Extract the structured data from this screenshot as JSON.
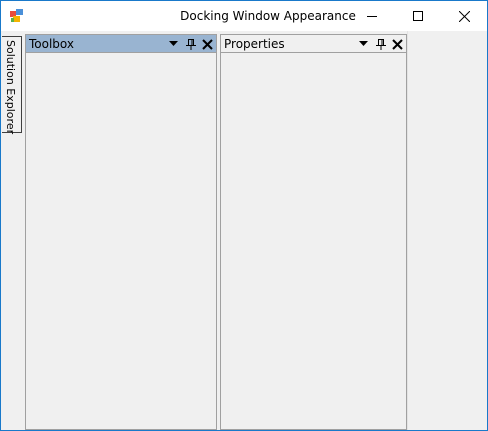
{
  "window": {
    "title": "Docking Window Appearance",
    "icon": "app-icon",
    "caption_buttons": [
      "minimize-icon",
      "maximize-icon",
      "close-icon"
    ]
  },
  "autohide": {
    "tab_label": "Solution Explorer"
  },
  "panels": [
    {
      "title": "Toolbox",
      "active": true
    },
    {
      "title": "Properties",
      "active": false
    }
  ],
  "colors": {
    "active_caption": "#99b4d1",
    "window_border": "#1979ca",
    "client_background": "#f0f0f0"
  }
}
